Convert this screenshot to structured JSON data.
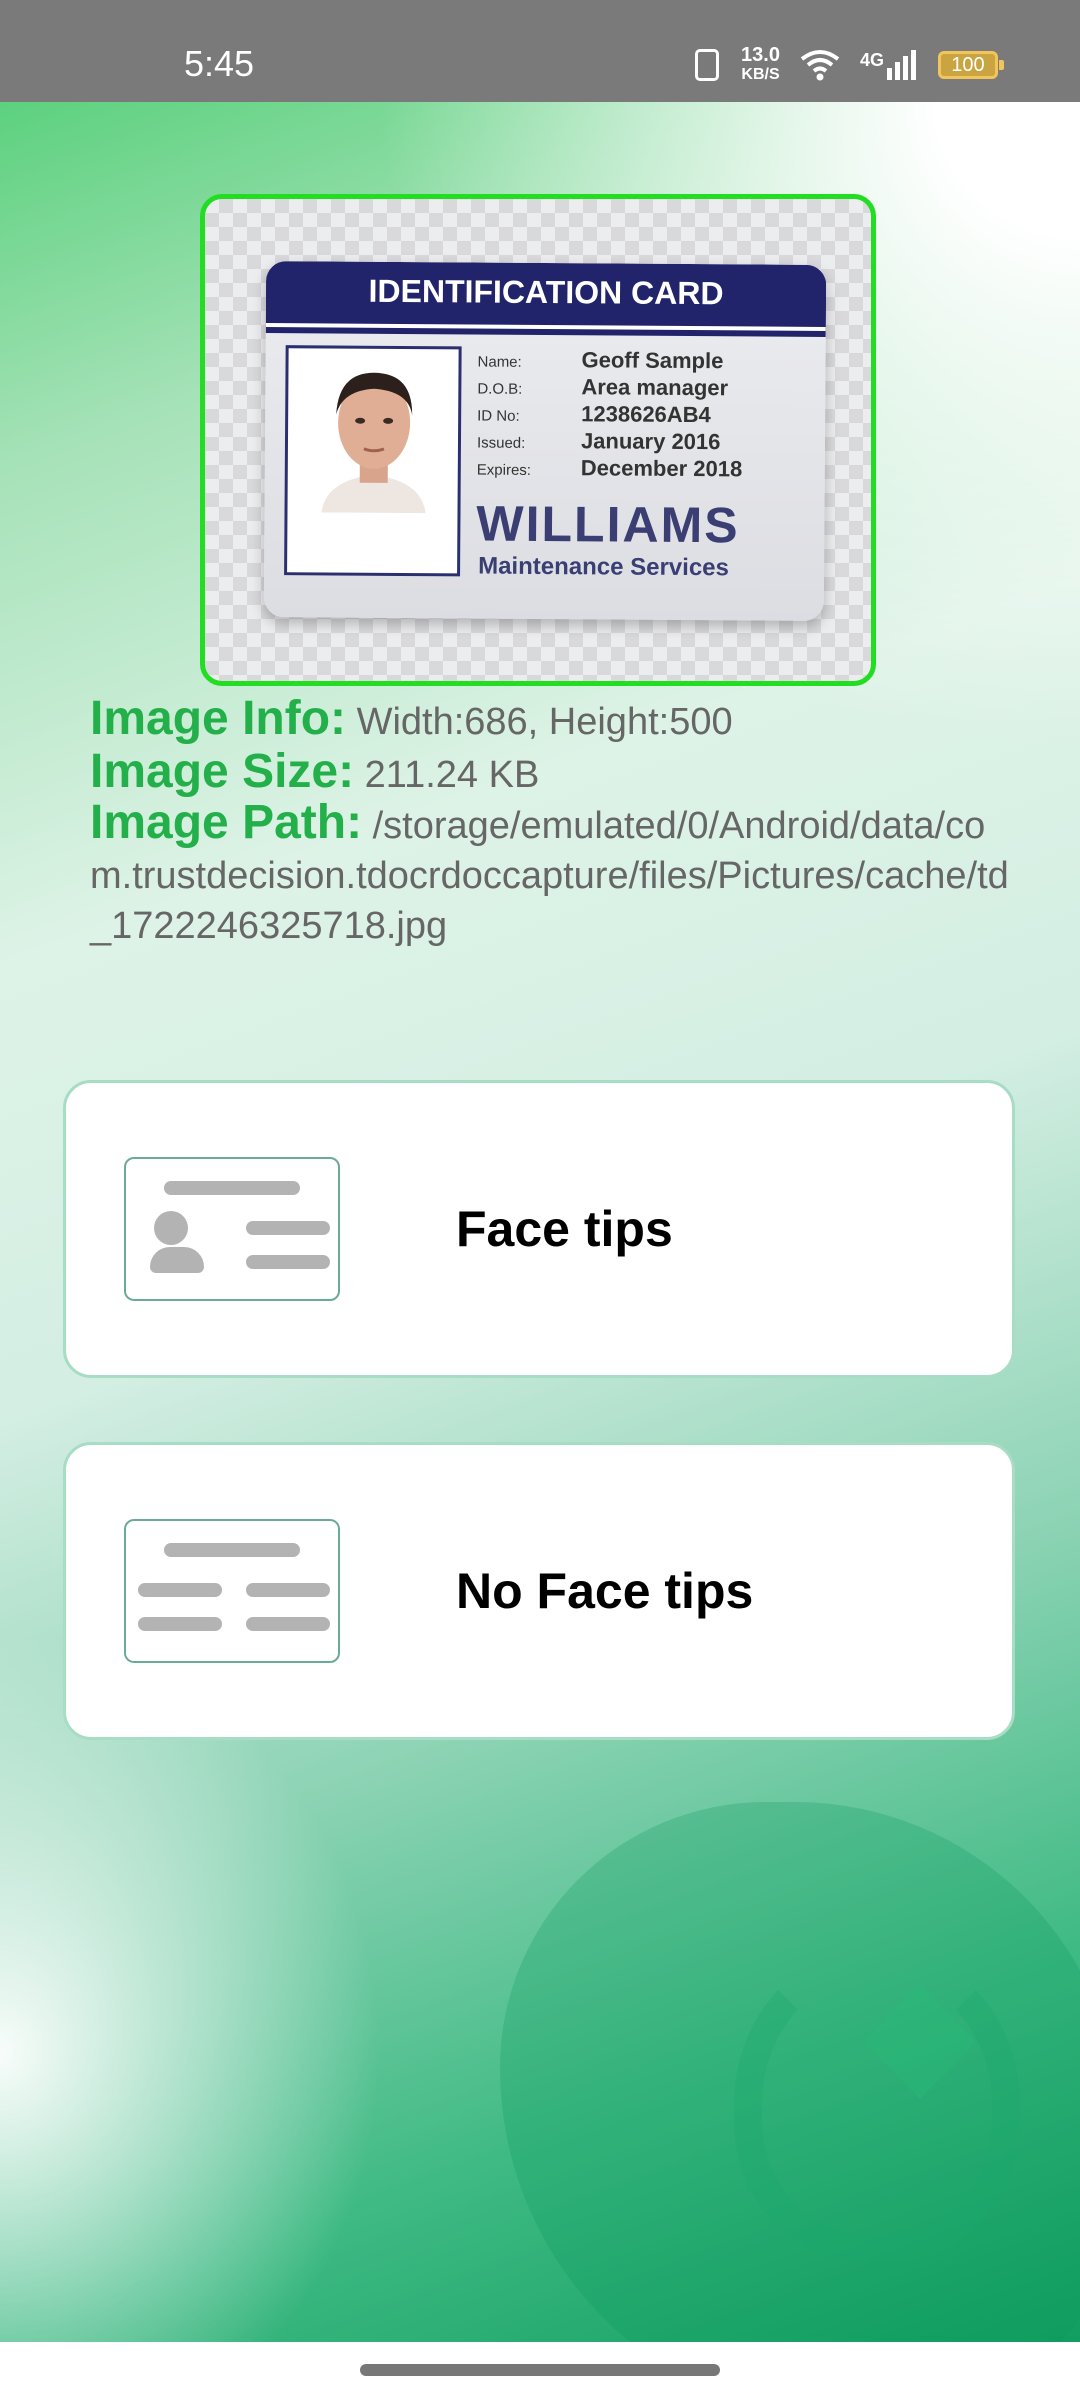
{
  "status_bar": {
    "time": "5:45",
    "network_speed_value": "13.0",
    "network_speed_unit": "KB/S",
    "cell_label": "4G",
    "battery": "100",
    "battery_color": "#c9a440"
  },
  "id_card": {
    "header": "IDENTIFICATION CARD",
    "fields": [
      {
        "label": "Name:",
        "value": "Geoff Sample"
      },
      {
        "label": "D.O.B:",
        "value": "Area manager"
      },
      {
        "label": "ID No:",
        "value": "1238626AB4"
      },
      {
        "label": "Issued:",
        "value": "January 2016"
      },
      {
        "label": "Expires:",
        "value": "December 2018"
      }
    ],
    "company": "WILLIAMS",
    "company_sub": "Maintenance Services",
    "frame_color": "#22dd22"
  },
  "image_info": {
    "info_label": "Image Info:",
    "info_value": "Width:686, Height:500",
    "size_label": "Image Size:",
    "size_value": "211.24 KB",
    "path_label": "Image Path:",
    "path_value": "/storage/emulated/0/Android/data/com.trustdecision.tdocrdoccapture/files/Pictures/cache/td_1722246325718.jpg",
    "label_color": "#23b04a"
  },
  "options": [
    {
      "label": "Face tips",
      "icon": "id-card-with-face-icon"
    },
    {
      "label": "No Face tips",
      "icon": "id-card-text-only-icon"
    }
  ]
}
